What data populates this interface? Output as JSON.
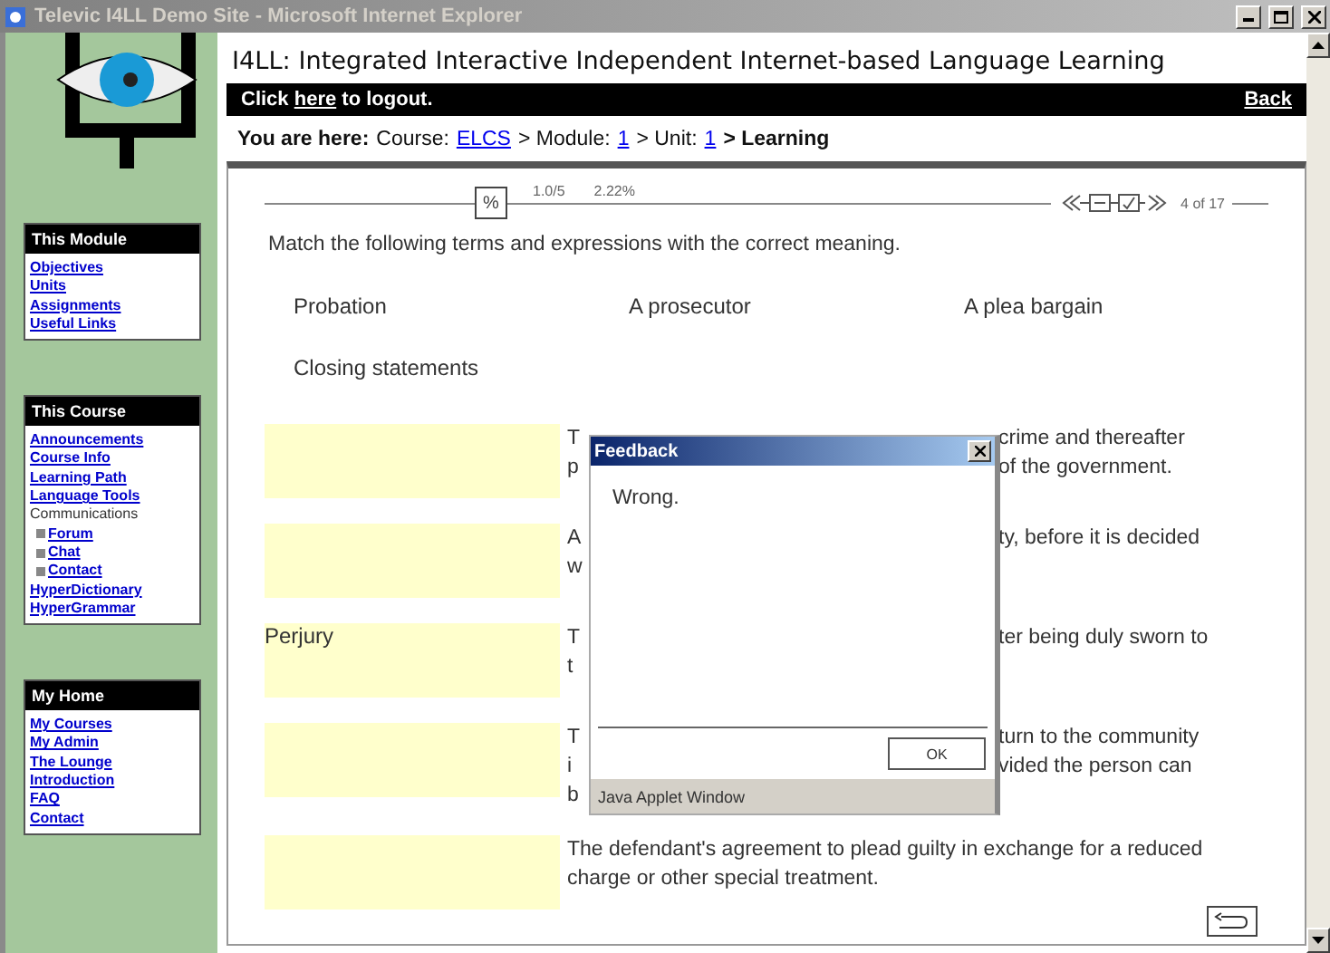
{
  "window": {
    "title": "Televic I4LL Demo Site - Microsoft Internet Explorer",
    "active": false
  },
  "header": {
    "title": "I4LL: Integrated Interactive Independent Internet-based Language Learning",
    "logout_before": "Click",
    "logout_link": "here",
    "logout_after": "to logout.",
    "back": "Back"
  },
  "breadcrumb": [
    {
      "kind": "label",
      "text": "You are here:"
    },
    {
      "kind": "text",
      "text": "Course:"
    },
    {
      "kind": "link",
      "text": "ELCS"
    },
    {
      "kind": "text",
      "text": "> Module:"
    },
    {
      "kind": "link",
      "text": "1"
    },
    {
      "kind": "text",
      "text": "> Unit:"
    },
    {
      "kind": "link",
      "text": "1"
    },
    {
      "kind": "current",
      "text": "> Learning"
    }
  ],
  "sidebar": [
    {
      "title": "This Module",
      "items": [
        {
          "label": "Objectives",
          "kind": "link"
        },
        {
          "label": "Units",
          "kind": "link"
        },
        {
          "label": "Assignments",
          "kind": "link"
        },
        {
          "label": "Useful Links",
          "kind": "link"
        }
      ]
    },
    {
      "title": "This Course",
      "items": [
        {
          "label": "Announcements",
          "kind": "link"
        },
        {
          "label": "Course Info",
          "kind": "link"
        },
        {
          "label": "Learning Path",
          "kind": "link"
        },
        {
          "label": "Language Tools",
          "kind": "link"
        },
        {
          "label": "Communications",
          "kind": "text",
          "children": [
            {
              "label": "Forum",
              "kind": "link"
            },
            {
              "label": "Chat",
              "kind": "link"
            },
            {
              "label": "Contact",
              "kind": "link"
            }
          ]
        },
        {
          "label": "HyperDictionary",
          "kind": "link"
        },
        {
          "label": "HyperGrammar",
          "kind": "link"
        }
      ]
    },
    {
      "title": "My Home",
      "items": [
        {
          "label": "My Courses",
          "kind": "link"
        },
        {
          "label": "My Admin",
          "kind": "link"
        },
        {
          "label": "The Lounge",
          "kind": "link"
        },
        {
          "label": "Introduction",
          "kind": "link"
        },
        {
          "label": "FAQ",
          "kind": "link"
        },
        {
          "label": "Contact",
          "kind": "link"
        }
      ]
    }
  ],
  "toolbar": {
    "percent_button": "%",
    "score": "1.0/5",
    "progress": "2.22%",
    "position": "4 of 17"
  },
  "instruction": "Match the following terms and expressions with the correct meaning.",
  "terms": [
    {
      "text": "Probation"
    },
    {
      "text": "A prosecutor"
    },
    {
      "text": "A plea bargain"
    },
    {
      "text": "Closing statements"
    }
  ],
  "definitions": [
    {
      "lines": [
        {
          "left": "T",
          "right": "crime and thereafter"
        },
        {
          "left": "p",
          "right": "of the government."
        }
      ]
    },
    {
      "lines": [
        {
          "left": "A",
          "right": "ty, before it is decided"
        },
        {
          "left": "w"
        }
      ]
    },
    {
      "answer": "Perjury",
      "lines": [
        {
          "left": "T",
          "right": "ter being duly sworn to"
        },
        {
          "left": "t"
        }
      ]
    },
    {
      "lines": [
        {
          "left": "T",
          "right": "turn to the community"
        },
        {
          "left": "i",
          "right": "vided the person can"
        },
        {
          "left": "b"
        }
      ]
    },
    {
      "text": "The defendant's agreement to plead guilty in exchange for a reduced charge or other special treatment."
    }
  ],
  "dialog": {
    "title": "Feedback",
    "message": "Wrong.",
    "ok": "OK",
    "footer": "Java Applet Window"
  }
}
